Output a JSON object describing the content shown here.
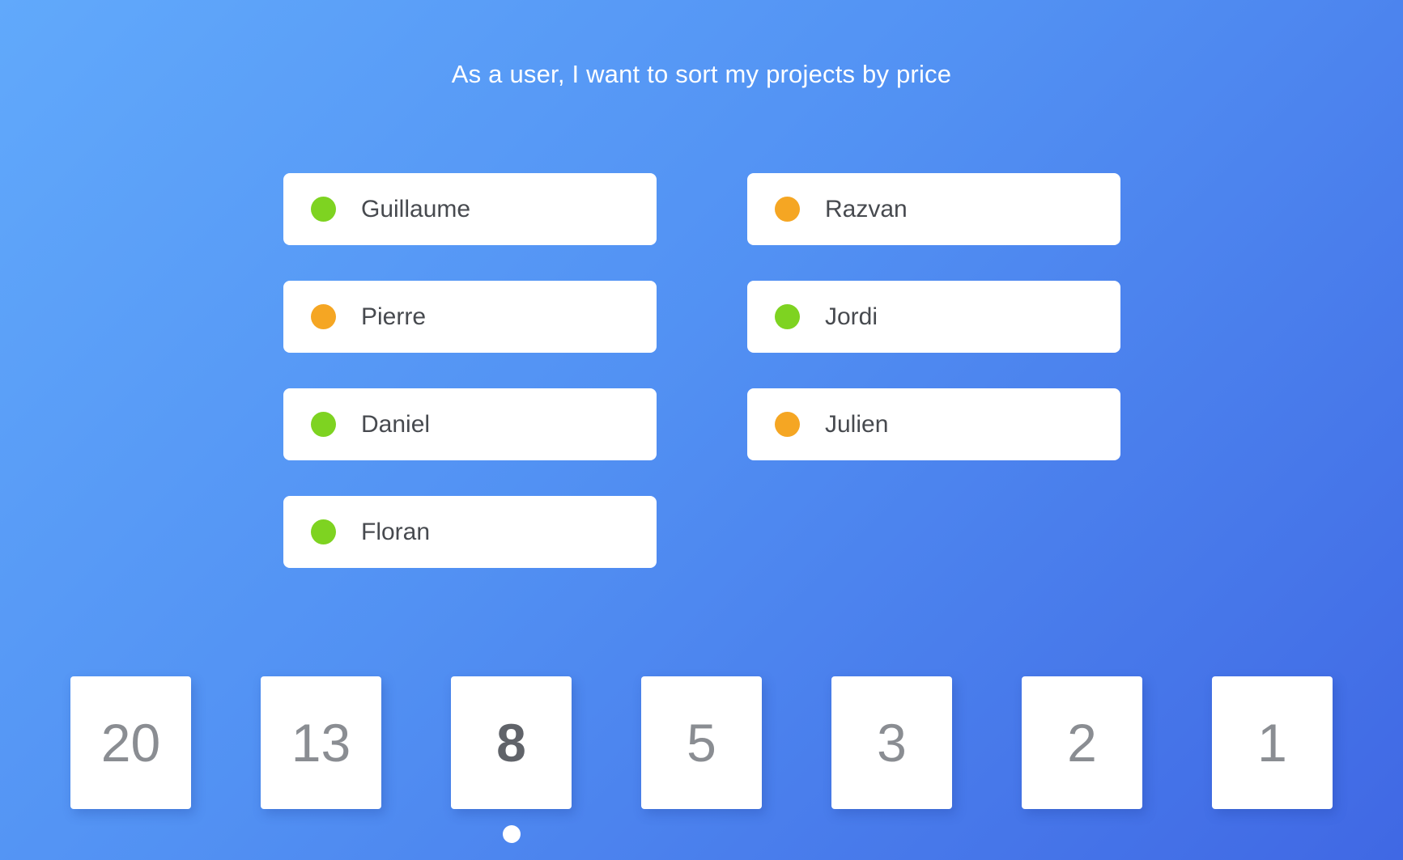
{
  "story": {
    "title": "As a user, I want to sort my projects by price"
  },
  "colors": {
    "voted": "#7ed321",
    "pending": "#f5a623",
    "background_start": "#61a9fb",
    "background_end": "#4068e4"
  },
  "participants": [
    {
      "name": "Guillaume",
      "status": "voted"
    },
    {
      "name": "Razvan",
      "status": "pending"
    },
    {
      "name": "Pierre",
      "status": "pending"
    },
    {
      "name": "Jordi",
      "status": "voted"
    },
    {
      "name": "Daniel",
      "status": "voted"
    },
    {
      "name": "Julien",
      "status": "pending"
    },
    {
      "name": "Floran",
      "status": "voted"
    }
  ],
  "cards": [
    {
      "value": "20"
    },
    {
      "value": "13"
    },
    {
      "value": "8",
      "selected": true
    },
    {
      "value": "5"
    },
    {
      "value": "3"
    },
    {
      "value": "2"
    },
    {
      "value": "1"
    }
  ]
}
